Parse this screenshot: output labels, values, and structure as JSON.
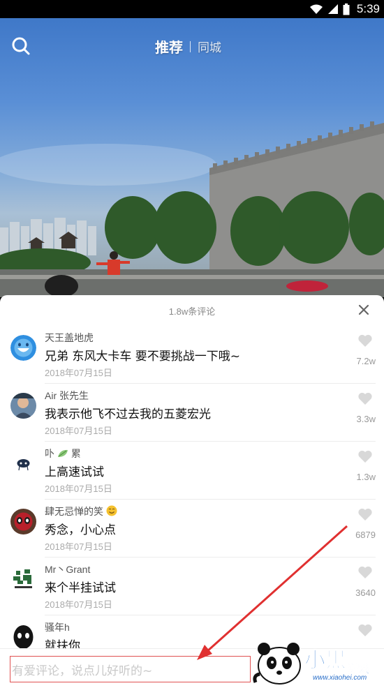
{
  "status_bar": {
    "time": "5:39"
  },
  "top_nav": {
    "tabs": [
      {
        "label": "推荐",
        "active": true
      },
      {
        "label": "同城",
        "active": false
      }
    ]
  },
  "comments_panel": {
    "title": "1.8w条评论",
    "input_placeholder": "有爱评论，说点儿好听的~",
    "comments": [
      {
        "username": "天王盖地虎",
        "text": "兄弟 东风大卡车 要不要挑战一下哦~",
        "date": "2018年07月15日",
        "likes": "7.2w"
      },
      {
        "username": "Air  张先生",
        "text": "我表示他飞不过去我的五菱宏光",
        "date": "2018年07月15日",
        "likes": "3.3w"
      },
      {
        "username": "卟",
        "username_suffix": "累",
        "text": "上高速试试",
        "date": "2018年07月15日",
        "likes": "1.3w"
      },
      {
        "username": "肆无忌惮的笑",
        "text": "秀念，小心点",
        "date": "2018年07月15日",
        "likes": "6879"
      },
      {
        "username": "Mr丶Grant",
        "text": "来个半挂试试",
        "date": "2018年07月15日",
        "likes": "3640"
      },
      {
        "username": "骚年h",
        "text": "就扶你",
        "date": "",
        "likes": ""
      }
    ]
  },
  "watermark": {
    "logo_text": "小黑游戏",
    "url": "www.xiaohei.com"
  },
  "colors": {
    "annotation_red": "#e03030",
    "brand_blue": "#1e6fd0"
  }
}
